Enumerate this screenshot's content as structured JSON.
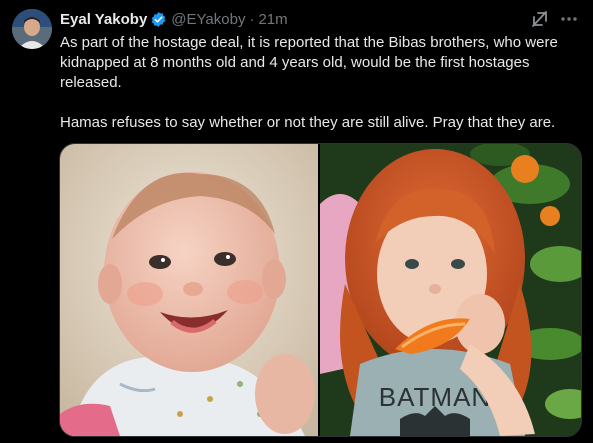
{
  "tweet": {
    "author_name": "Eyal Yakoby",
    "handle": "@EYakoby",
    "separator": "·",
    "time": "21m",
    "paragraphs": [
      "As part of the hostage deal, it is reported that the Bibas brothers, who were kidnapped at 8 months old and 4 years old, would be the first hostages released.",
      "Hamas refuses to say whether or not they are still alive. Pray that they are."
    ],
    "shirt_text": "BATMAN"
  },
  "icons": {
    "verified": "verified-badge-icon",
    "grok": "grok-icon",
    "more": "more-options-icon"
  },
  "colors": {
    "background": "#000000",
    "text": "#e7e9ea",
    "muted": "#71767b",
    "verified_blue": "#1d9bf0",
    "border": "#2f3336"
  }
}
